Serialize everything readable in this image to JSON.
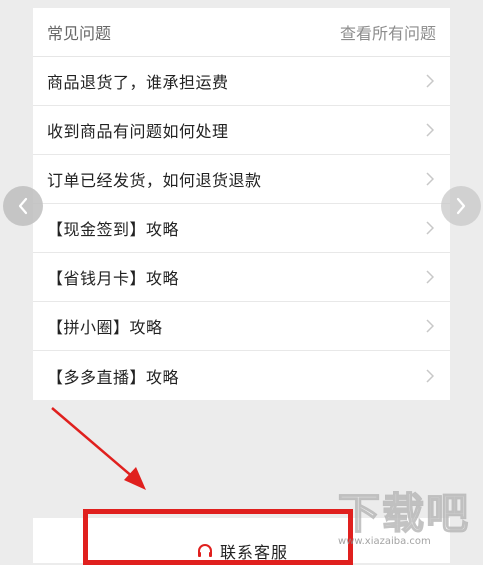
{
  "faq": {
    "title": "常见问题",
    "view_all": "查看所有问题",
    "items": [
      {
        "label": "商品退货了，谁承担运费"
      },
      {
        "label": "收到商品有问题如何处理"
      },
      {
        "label": "订单已经发货，如何退货退款"
      },
      {
        "label": "【现金签到】攻略"
      },
      {
        "label": "【省钱月卡】攻略"
      },
      {
        "label": "【拼小圈】攻略"
      },
      {
        "label": "【多多直播】攻略"
      }
    ]
  },
  "carousel": {
    "prev_icon": "chevron-left-icon",
    "next_icon": "chevron-right-icon"
  },
  "contact": {
    "label": "联系客服",
    "icon": "headset-icon",
    "icon_color": "#e0201e"
  },
  "annotation": {
    "arrow_color": "#e0201e",
    "highlight_color": "#e0201e"
  },
  "watermark": {
    "text": "下载吧",
    "sub": "www.xiazaiba.com"
  }
}
